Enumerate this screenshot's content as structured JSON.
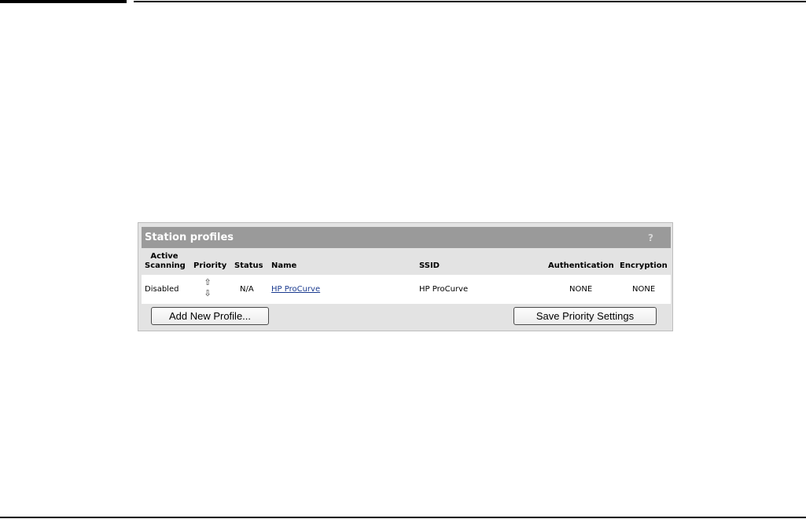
{
  "panel": {
    "title": "Station profiles",
    "help": "?"
  },
  "columns": {
    "active_scanning_line1": "Active",
    "active_scanning_line2": "Scanning",
    "priority": "Priority",
    "status": "Status",
    "name": "Name",
    "ssid": "SSID",
    "authentication": "Authentication",
    "encryption": "Encryption"
  },
  "rows": [
    {
      "active_scanning": "Disabled",
      "priority_up": "⇧",
      "priority_down": "⇩",
      "status": "N/A",
      "name": "HP ProCurve",
      "ssid": "HP ProCurve",
      "authentication": "NONE",
      "encryption": "NONE"
    }
  ],
  "buttons": {
    "add_profile": "Add New Profile...",
    "save_priority": "Save Priority Settings"
  }
}
